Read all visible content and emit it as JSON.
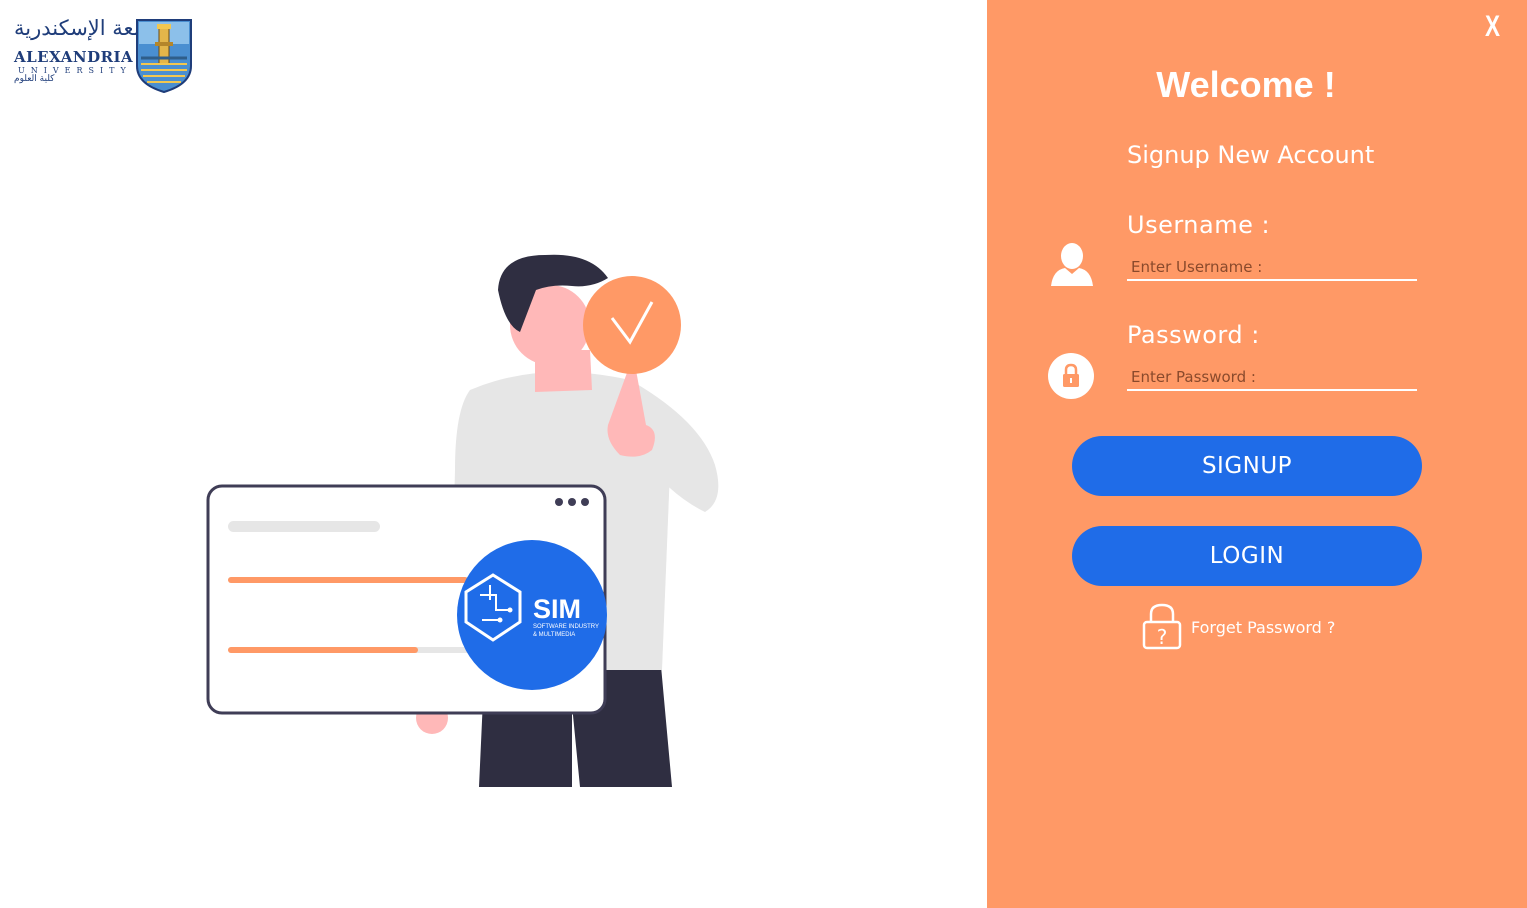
{
  "colors": {
    "accent_panel": "#ff9966",
    "button": "#1f6ce8",
    "text_on_panel": "#ffffff"
  },
  "logo": {
    "arabic_name": "جامعة الإسكندرية",
    "english_name": "ALEXANDRIA",
    "english_sub": "UNIVERSITY",
    "arabic_faculty": "كلية العلوم"
  },
  "illustration": {
    "badge_title": "SIM",
    "badge_subtitle_1": "SOFTWARE INDUSTRY",
    "badge_subtitle_2": "& MULTIMEDIA",
    "check_icon": "checkmark-icon"
  },
  "panel": {
    "close_label": "X",
    "welcome": "Welcome !",
    "subtitle": "Signup New Account",
    "username": {
      "label": "Username :",
      "placeholder": "Enter Username :",
      "icon": "user-icon"
    },
    "password": {
      "label": "Password :",
      "placeholder": "Enter Password :",
      "icon": "lock-icon"
    },
    "signup_label": "SIGNUP",
    "login_label": "LOGIN",
    "forget_label": "Forget Password ?",
    "forget_icon": "lock-question-icon"
  }
}
